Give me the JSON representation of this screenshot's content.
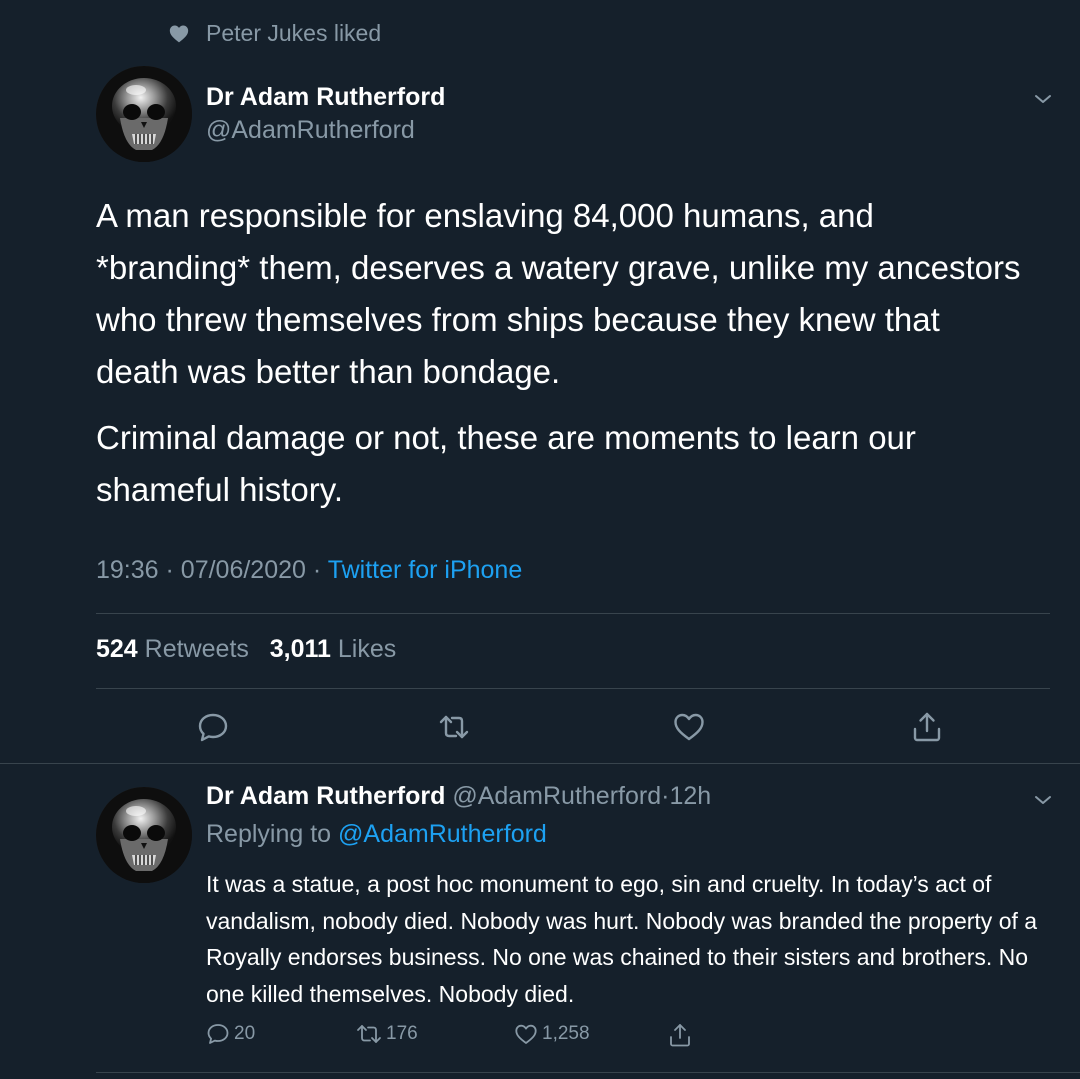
{
  "social_context": {
    "icon": "heart-icon",
    "text": "Peter Jukes liked"
  },
  "main_tweet": {
    "author_name": "Dr Adam Rutherford",
    "author_handle": "@AdamRutherford",
    "paragraphs": [
      "A man responsible for enslaving 84,000 humans, and *branding* them, deserves a watery grave, unlike my ancestors who threw themselves from ships because they knew that death was better than bondage.",
      "Criminal damage or not, these are moments to learn our shameful history."
    ],
    "time": "19:36",
    "date": "07/06/2020",
    "separator": "·",
    "source": "Twitter for iPhone",
    "retweets_count": "524",
    "retweets_label": "Retweets",
    "likes_count": "3,011",
    "likes_label": "Likes"
  },
  "reply_tweet": {
    "author_name": "Dr Adam Rutherford",
    "author_handle": "@AdamRutherford",
    "separator": "·",
    "time_ago": "12h",
    "replying_prefix": "Replying to",
    "replying_handle": "@AdamRutherford",
    "text": "It was a statue, a post hoc monument to ego, sin and cruelty. In today’s act of vandalism, nobody died. Nobody was hurt. Nobody was branded the property of a Royally endorses business. No one was chained to their sisters and brothers. No one killed themselves. Nobody died.",
    "reply_count": "20",
    "retweet_count": "176",
    "like_count": "1,258"
  },
  "colors": {
    "background": "#15202b",
    "text": "#ffffff",
    "muted": "#8899a6",
    "accent": "#1da1f2",
    "divider": "#38444d"
  }
}
